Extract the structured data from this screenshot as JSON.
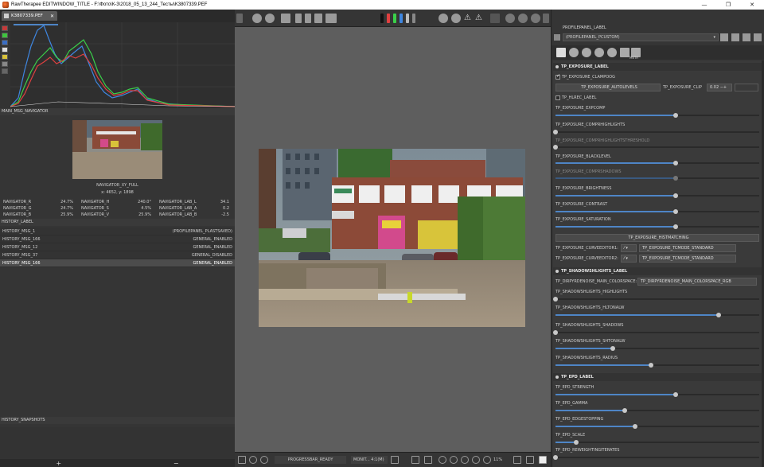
{
  "window": {
    "title": "RawTherapee EDITWINDOW_TITLE - F:\\Фото\\К-3\\2018_05_13_244_Тесты\\K3807339.PEF",
    "min": "—",
    "max": "❐",
    "close": "✕"
  },
  "file_tab": {
    "label": "K3807339.PEF",
    "close": "✕"
  },
  "navigator": {
    "section_label": "MAIN_MSG_NAVIGATOR",
    "xy_label": "NAVIGATOR_XY_FULL",
    "xy_values": "x: 4652, y: 1898",
    "values": [
      {
        "label": "NAVIGATOR_R",
        "value": "24.7%"
      },
      {
        "label": "NAVIGATOR_H",
        "value": "240.0°"
      },
      {
        "label": "NAVIGATOR_LAB_L",
        "value": "34.1"
      },
      {
        "label": "NAVIGATOR_G",
        "value": "24.7%"
      },
      {
        "label": "NAVIGATOR_S",
        "value": "4.5%"
      },
      {
        "label": "NAVIGATOR_LAB_A",
        "value": "0.2"
      },
      {
        "label": "NAVIGATOR_B",
        "value": "25.9%"
      },
      {
        "label": "NAVIGATOR_V",
        "value": "25.9%"
      },
      {
        "label": "NAVIGATOR_LAB_B",
        "value": "-2.5"
      }
    ]
  },
  "history": {
    "section_label": "HISTORY_LABEL",
    "rows": [
      {
        "name": "HISTORY_MSG_1",
        "value": "(PROFILEPANEL_PLASTSAVED)"
      },
      {
        "name": "HISTORY_MSG_166",
        "value": "GENERAL_ENABLED"
      },
      {
        "name": "HISTORY_MSG_12",
        "value": "GENERAL_ENABLED"
      },
      {
        "name": "HISTORY_MSG_37",
        "value": "GENERAL_DISABLED"
      },
      {
        "name": "HISTORY_MSG_166",
        "value": "GENERAL_ENABLED"
      }
    ]
  },
  "snapshots": {
    "section_label": "HISTORY_SNAPSHOTS",
    "add": "+",
    "remove": "−"
  },
  "status": {
    "progress": "PROGRESSBAR_READY",
    "monitor": "MONIT... 4:1(M)",
    "zoom": "11%"
  },
  "profile": {
    "panel_label": "PROFILEPANEL_LABEL",
    "combo": "(PROFILEPANEL_PCUSTOM)",
    "meta_tab": "META"
  },
  "exposure": {
    "section": "TP_EXPOSURE_LABEL",
    "clampoog": "TP_EXPOSURE_CLAMPOOG",
    "autolevels": "TP_EXPOSURE_AUTOLEVELS",
    "clip_label": "TP_EXPOSURE_CLIP",
    "clip_value": "0.02",
    "hlrec": "TP_HLREC_LABEL",
    "expcomp": "TP_EXPOSURE_EXPCOMP",
    "comprhighlights": "TP_EXPOSURE_COMPRHIGHLIGHTS",
    "comprhighlightsthreshold": "TP_EXPOSURE_COMPRHIGHLIGHTSTHRESHOLD",
    "blacklevel": "TP_EXPOSURE_BLACKLEVEL",
    "comprshadows": "TP_EXPOSURE_COMPRSHADOWS",
    "brightness": "TP_EXPOSURE_BRIGHTNESS",
    "contrast": "TP_EXPOSURE_CONTRAST",
    "saturation": "TP_EXPOSURE_SATURATION",
    "histmatching": "TP_EXPOSURE_HISTMATCHING",
    "curveeditor1": "TP_EXPOSURE_CURVEEDITOR1:",
    "curveeditor2": "TP_EXPOSURE_CURVEEDITOR2:",
    "tcmode1": "TP_EXPOSURE_TCMODE_STANDARD",
    "tcmode2": "TP_EXPOSURE_TCMODE_STANDARD"
  },
  "shadows": {
    "section": "TP_SHADOWSHLIGHTS_LABEL",
    "colorspace_label": "TP_DIRPYRDENOISE_MAIN_COLORSPACE:",
    "colorspace_value": "TP_DIRPYRDENOISE_MAIN_COLORSPACE_RGB",
    "highlights": "TP_SHADOWSHLIGHTS_HIGHLIGHTS",
    "hltonalw": "TP_SHADOWSHLIGHTS_HLTONALW",
    "shadows": "TP_SHADOWSHLIGHTS_SHADOWS",
    "shtonalw": "TP_SHADOWSHLIGHTS_SHTONALW",
    "radius": "TP_SHADOWSHLIGHTS_RADIUS"
  },
  "epd": {
    "section": "TP_EPD_LABEL",
    "strength": "TP_EPD_STRENGTH",
    "gamma": "TP_EPD_GAMMA",
    "edgestopping": "TP_EPD_EDGESTOPPING",
    "scale": "TP_EPD_SCALE",
    "reweighting": "TP_EPD_REWEIGHTINGITERATES"
  },
  "slider_levels": {
    "expcomp": 0.59,
    "comprhighlights": 0.0,
    "comprhighlightsthreshold": 0.0,
    "blacklevel": 0.59,
    "comprshadows": 0.59,
    "brightness": 0.59,
    "contrast": 0.59,
    "saturation": 0.59,
    "sh_highlights": 0.0,
    "sh_hltonalw": 0.8,
    "sh_shadows": 0.0,
    "sh_shtonalw": 0.28,
    "sh_radius": 0.47,
    "epd_strength": 0.59,
    "epd_gamma": 0.34,
    "epd_edgestopping": 0.39,
    "epd_scale": 0.1,
    "epd_reweighting": 0.0
  },
  "colors": {
    "slider_fill": "#4e85c6",
    "panel_bg": "#353535",
    "canvas_bg": "#5e5e5e"
  }
}
